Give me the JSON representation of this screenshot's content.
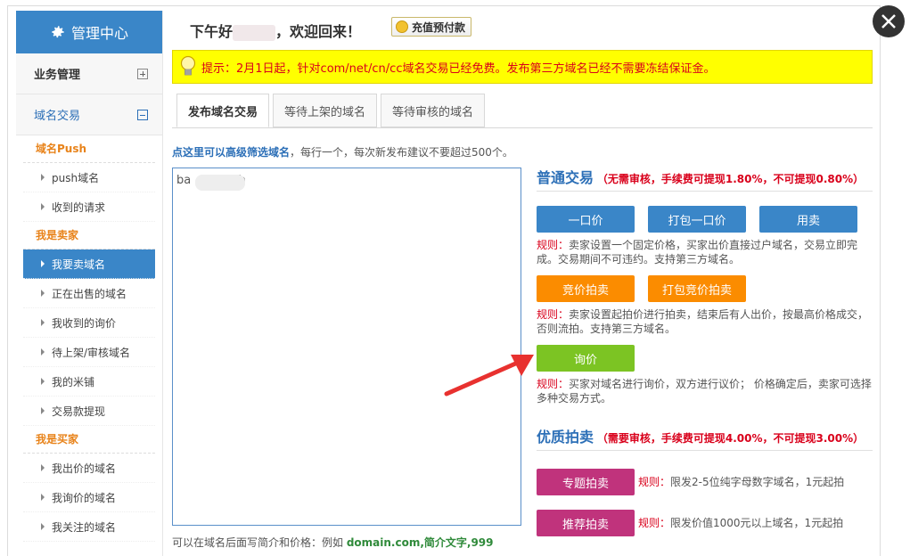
{
  "sidebar": {
    "title": "管理中心",
    "groups": [
      {
        "label": "业务管理"
      },
      {
        "label": "域名交易"
      }
    ],
    "sections": [
      {
        "label": "域名Push",
        "items": [
          "push域名",
          "收到的请求"
        ]
      },
      {
        "label": "我是卖家",
        "items": [
          "我要卖域名",
          "正在出售的域名",
          "我收到的询价",
          "待上架/审核域名",
          "我的米铺",
          "交易款提现"
        ]
      },
      {
        "label": "我是买家",
        "items": [
          "我出价的域名",
          "我询价的域名",
          "我关注的域名"
        ]
      }
    ]
  },
  "header": {
    "greet_prefix": "下午好",
    "greet_suffix": "，欢迎回来！",
    "recharge": "充值预付款"
  },
  "notice": "提示：2月1日起，针对com/net/cn/cc域名交易已经免费。发布第三方域名已经不需要冻结保证金。",
  "tabs": [
    "发布域名交易",
    "等待上架的域名",
    "等待审核的域名"
  ],
  "hint": {
    "link": "点这里可以高级筛选域名",
    "text": "，每行一个，每次新发布建议不要超过500个。"
  },
  "textarea_value": "ba          lub",
  "footer": {
    "text": "可以在域名后面写简介和价格：例如 ",
    "example": "domain.com,简介文字,999"
  },
  "normal": {
    "title": "普通交易",
    "subtitle": "（无需审核，手续费可提现1.80%，不可提现0.80%）",
    "buttons": [
      "一口价",
      "打包一口价",
      "用卖"
    ],
    "rule1_label": "规则：",
    "rule1": "卖家设置一个固定价格，买家出价直接过户域名，交易立即完成。交易期间不可违约。支持第三方域名。",
    "auction_buttons": [
      "竞价拍卖",
      "打包竞价拍卖"
    ],
    "rule2_label": "规则：",
    "rule2": "卖家设置起拍价进行拍卖，结束后有人出价，按最高价格成交，否则流拍。支持第三方域名。",
    "inquiry_button": "询价",
    "rule3_label": "规则：",
    "rule3": "买家对域名进行询价，双方进行议价；  价格确定后，卖家可选择多种交易方式。"
  },
  "premium": {
    "title": "优质拍卖",
    "subtitle": "（需要审核，手续费可提现4.00%，不可提现3.00%）",
    "b1": "专题拍卖",
    "r1_label": "规则：",
    "r1": "限发2-5位纯字母数字域名，1元起拍",
    "b2": "推荐拍卖",
    "r2_label": "规则：",
    "r2": "限发价值1000元以上域名，1元起拍"
  },
  "colors": {
    "accent": "#3a86c8",
    "notice_bg": "#ffff00",
    "warn": "#d9001b",
    "orange": "#fb8c00",
    "green": "#7cc423",
    "magenta": "#c0337c"
  }
}
